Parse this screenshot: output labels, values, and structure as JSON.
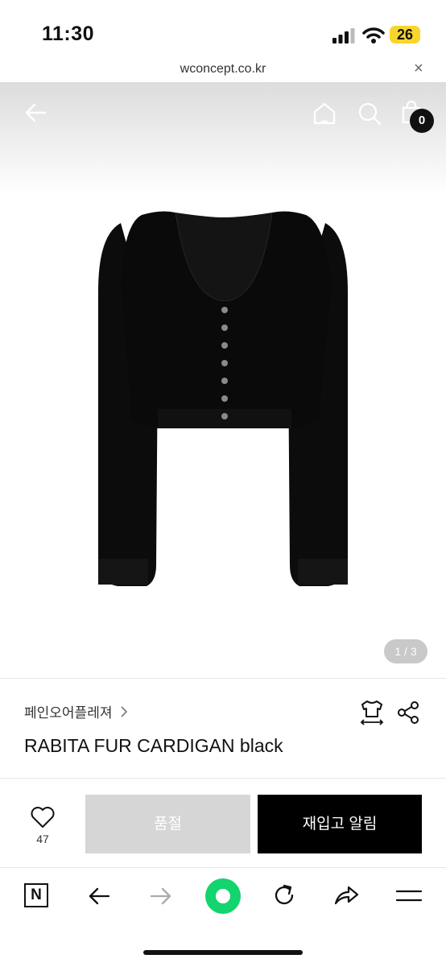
{
  "status_bar": {
    "time": "11:30",
    "battery": "26"
  },
  "browser": {
    "url": "wconcept.co.kr",
    "close_icon": "×"
  },
  "header": {
    "cart_count": "0"
  },
  "gallery": {
    "counter": "1 / 3"
  },
  "product": {
    "brand": "페인오어플레져",
    "name": "RABITA FUR CARDIGAN black"
  },
  "actions": {
    "like_count": "47",
    "soldout_label": "품절",
    "restock_label": "재입고 알림"
  },
  "toolbar": {
    "n_label": "N"
  }
}
